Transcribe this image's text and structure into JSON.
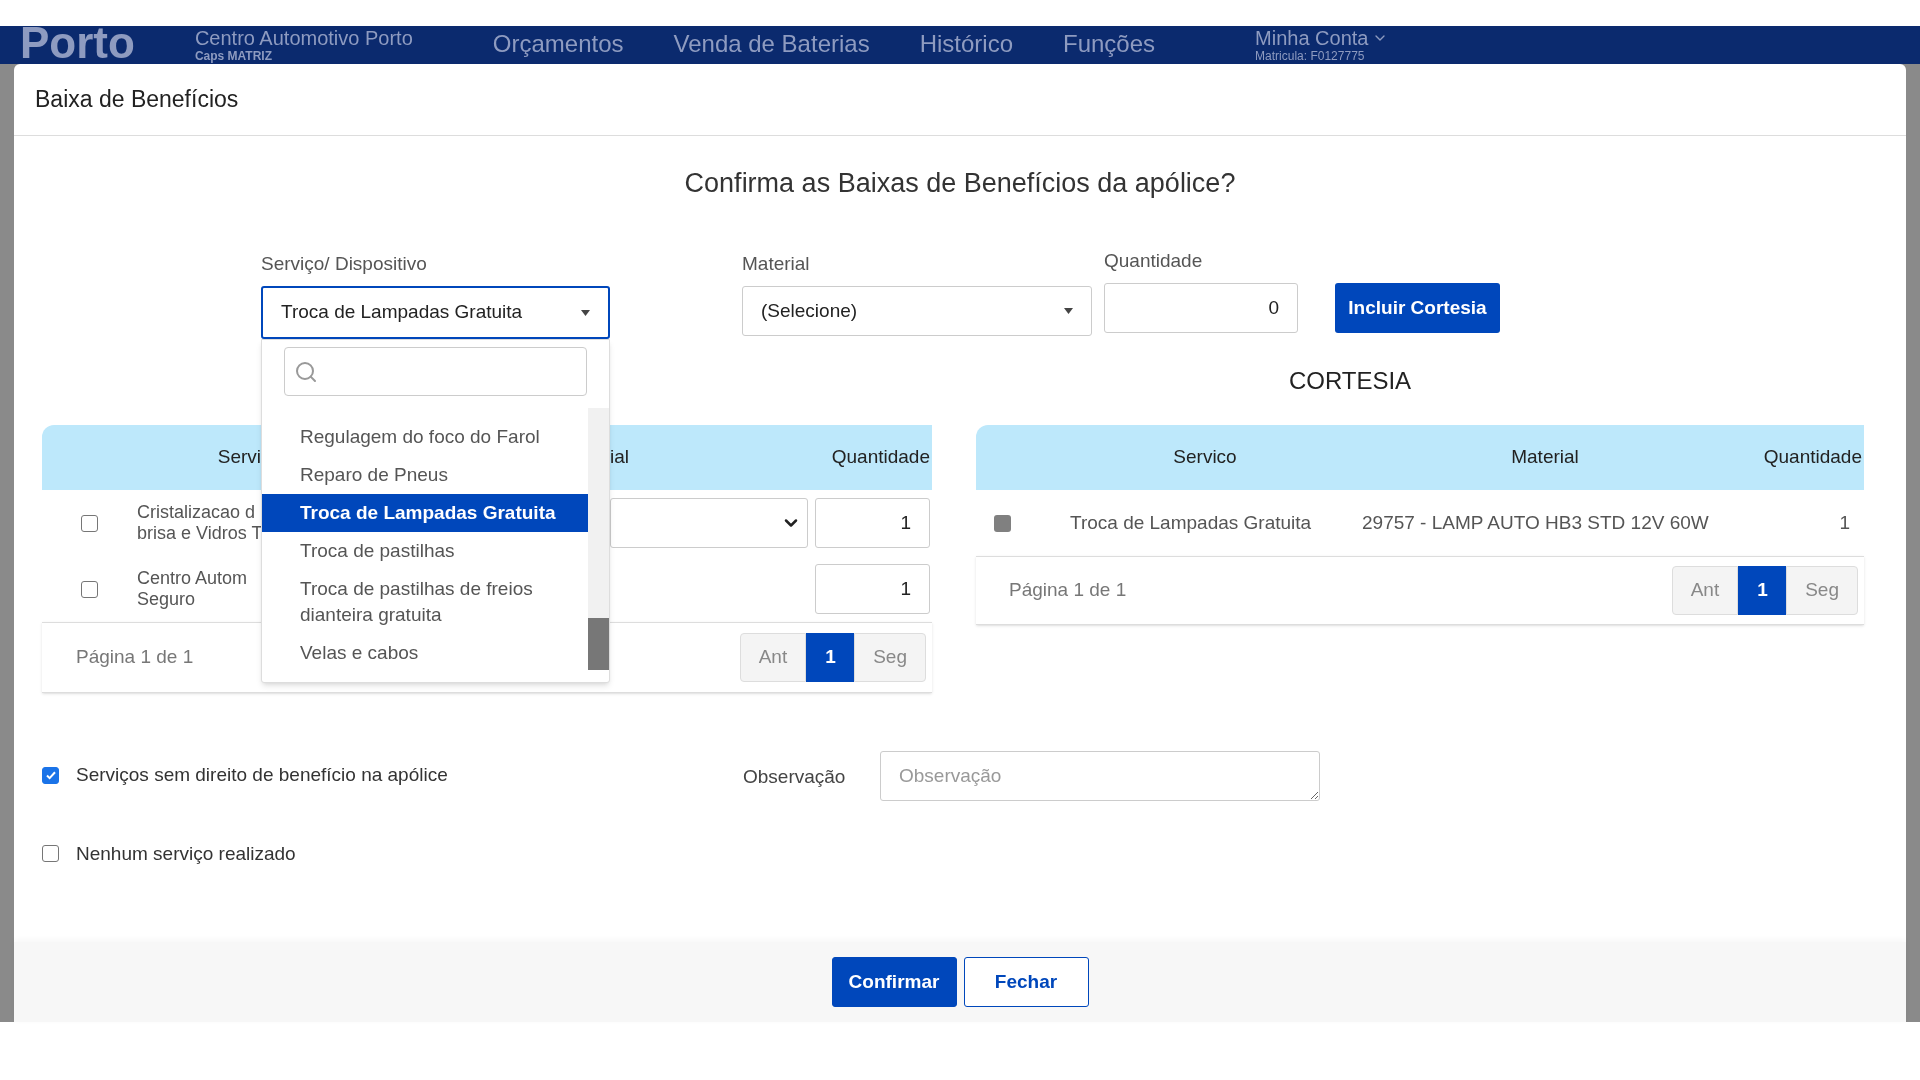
{
  "nav": {
    "logo": "Porto",
    "store": "Centro Automotivo Porto",
    "store_sub": "Caps MATRIZ",
    "menu": [
      "Orçamentos",
      "Venda de Baterias",
      "Histórico",
      "Funções"
    ],
    "account": "Minha Conta",
    "account_sub": "Matricula: F0127775"
  },
  "modal": {
    "title": "Baixa de Benefícios",
    "question": "Confirma as Baixas de Benefícios da apólice?"
  },
  "form": {
    "service_label": "Serviço/ Dispositivo",
    "service_value": "Troca de Lampadas Gratuita",
    "material_label": "Material",
    "material_value": "(Selecione)",
    "quantity_label": "Quantidade",
    "quantity_value": "0",
    "add_button": "Incluir Cortesia"
  },
  "dropdown": {
    "expanded": true,
    "options": [
      {
        "label": "Regulagem do foco do Farol",
        "selected": false
      },
      {
        "label": "Reparo de Pneus",
        "selected": false
      },
      {
        "label": "Troca de Lampadas Gratuita",
        "selected": true
      },
      {
        "label": "Troca de pastilhas",
        "selected": false
      },
      {
        "label": "Troca de pastilhas de freios dianteira gratuita",
        "selected": false
      },
      {
        "label": "Velas e cabos",
        "selected": false
      }
    ]
  },
  "services_table": {
    "columns": [
      "Servi",
      "ial",
      "Quantidade"
    ],
    "rows": [
      {
        "checked": false,
        "service": [
          "Cristalizacao d",
          "brisa e Vidros T"
        ],
        "material_field": true,
        "quantity": "1"
      },
      {
        "checked": false,
        "service": [
          "Centro Autom",
          "Seguro"
        ],
        "material_field": false,
        "quantity": "1"
      }
    ],
    "pagination": {
      "text": "Página 1 de 1",
      "buttons": [
        {
          "label": "Ant",
          "selected": false
        },
        {
          "label": "1",
          "selected": true
        },
        {
          "label": "Seg",
          "selected": false
        }
      ]
    }
  },
  "cortesia_table": {
    "title": "CORTESIA",
    "columns": [
      "Servico",
      "Material",
      "Quantidade"
    ],
    "rows": [
      {
        "disabled": true,
        "service": "Troca de Lampadas Gratuita",
        "material": "29757 - LAMP AUTO HB3 STD 12V 60W",
        "quantity": "1"
      }
    ],
    "pagination": {
      "text": "Página 1 de 1",
      "buttons": [
        {
          "label": "Ant",
          "selected": false
        },
        {
          "label": "1",
          "selected": true
        },
        {
          "label": "Seg",
          "selected": false
        }
      ]
    }
  },
  "options": [
    {
      "label": "Serviços sem direito de benefício na apólice",
      "checked": true
    },
    {
      "label": "Nenhum serviço realizado",
      "checked": false
    }
  ],
  "observation": {
    "label": "Observação",
    "placeholder": "Observação"
  },
  "footer": {
    "buttons": [
      {
        "label": "Confirmar",
        "kind": "primary"
      },
      {
        "label": "Fechar",
        "kind": "secondary"
      }
    ]
  }
}
